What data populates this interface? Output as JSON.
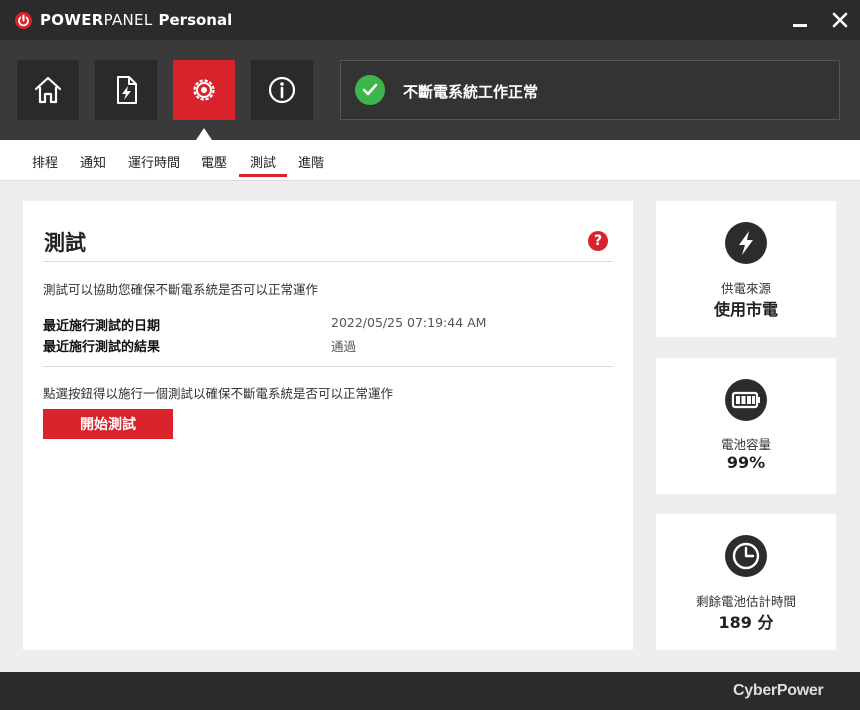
{
  "app": {
    "title_bold": "POWER",
    "title_light": "PANEL",
    "title_suffix": "Personal"
  },
  "window": {
    "minimize_icon": "minimize-icon",
    "close_icon": "close-icon"
  },
  "toolbar": {
    "buttons": [
      {
        "icon": "home-icon",
        "active": false
      },
      {
        "icon": "power-status-icon",
        "active": false
      },
      {
        "icon": "gear-icon",
        "active": true
      },
      {
        "icon": "info-icon",
        "active": false
      }
    ],
    "status_text": "不斷電系統工作正常",
    "status_color": "#3cb54a"
  },
  "subtabs": {
    "items": [
      "排程",
      "通知",
      "運行時間",
      "電壓",
      "測試",
      "進階"
    ],
    "active": "測試"
  },
  "main": {
    "title": "測試",
    "description": "測試可以協助您確保不斷電系統是否可以正常運作",
    "last_test_date_label": "最近施行測試的日期",
    "last_test_date_value": "2022/05/25 07:19:44 AM",
    "last_test_result_label": "最近施行測試的結果",
    "last_test_result_value": "通過",
    "prompt": "點選按鈕得以施行一個測試以確保不斷電系統是否可以正常運作",
    "start_button": "開始測試"
  },
  "cards": [
    {
      "icon": "lightning-icon",
      "label": "供電來源",
      "value": "使用市電"
    },
    {
      "icon": "battery-icon",
      "label": "電池容量",
      "value": "99%"
    },
    {
      "icon": "clock-icon",
      "label": "剩餘電池估計時間",
      "value": "189 分"
    }
  ],
  "footer": {
    "brand": "CyberPower"
  },
  "colors": {
    "accent": "#d8232a",
    "dark_bg": "#2b2b2b",
    "success": "#3cb54a"
  }
}
